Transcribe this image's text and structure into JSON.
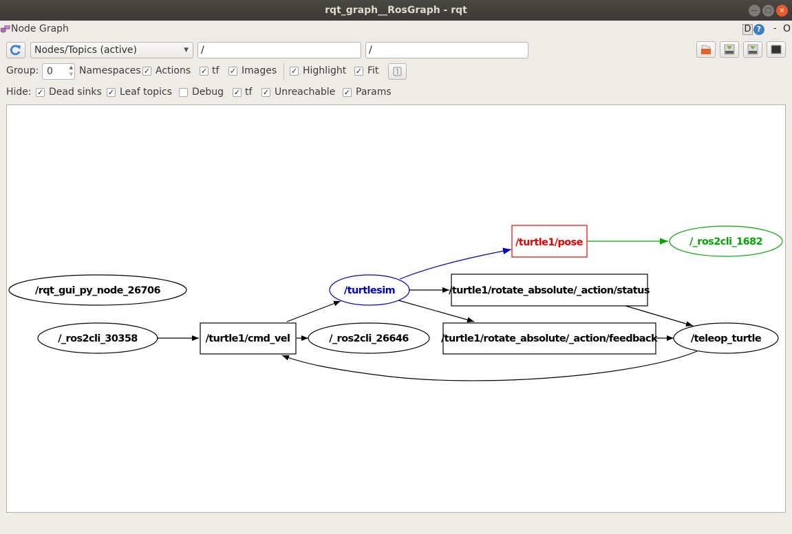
{
  "window": {
    "title": "rqt_graph__RosGraph - rqt",
    "controls": {
      "minimize": "—",
      "maximize": "□",
      "close": "×"
    }
  },
  "plugin": {
    "title": "Node Graph",
    "icon": "node-graph-icon",
    "dock_buttons": {
      "d": "D",
      "help": "?",
      "minus": "-",
      "close": "O"
    }
  },
  "toolbar": {
    "refresh_icon": "refresh-icon",
    "mode_select": {
      "value": "Nodes/Topics (active)"
    },
    "node_filter": {
      "value": "/"
    },
    "topic_filter": {
      "value": "/"
    },
    "right_buttons": [
      "load-dot-icon",
      "save-dot-icon",
      "save-image-icon",
      "fit-view-icon"
    ]
  },
  "options": {
    "group_label": "Group:",
    "group_value": "0",
    "namespaces_label": "Namespaces",
    "checks": [
      {
        "label": "Actions",
        "checked": true
      },
      {
        "label": "tf",
        "checked": true
      },
      {
        "label": "Images",
        "checked": true
      },
      {
        "label": "Highlight",
        "checked": true
      },
      {
        "label": "Fit",
        "checked": true
      }
    ]
  },
  "hide": {
    "label": "Hide:",
    "checks": [
      {
        "label": "Dead sinks",
        "checked": true
      },
      {
        "label": "Leaf topics",
        "checked": true
      },
      {
        "label": "Debug",
        "checked": false
      },
      {
        "label": "tf",
        "checked": true
      },
      {
        "label": "Unreachable",
        "checked": true
      },
      {
        "label": "Params",
        "checked": true
      }
    ]
  },
  "graph": {
    "colors": {
      "default": "#000000",
      "selected": "#0000cc",
      "outgoing": "#ee0000",
      "incoming": "#00aa00"
    },
    "nodes": [
      {
        "id": "rqt_gui",
        "label": "/rqt_gui_py_node_26706",
        "shape": "ellipse",
        "color": "#000000"
      },
      {
        "id": "ros2cli_30358",
        "label": "/_ros2cli_30358",
        "shape": "ellipse",
        "color": "#000000"
      },
      {
        "id": "cmd_vel",
        "label": "/turtle1/cmd_vel",
        "shape": "box",
        "color": "#000000"
      },
      {
        "id": "ros2cli_26646",
        "label": "/_ros2cli_26646",
        "shape": "ellipse",
        "color": "#000000"
      },
      {
        "id": "turtlesim",
        "label": "/turtlesim",
        "shape": "ellipse",
        "color": "#0000cc"
      },
      {
        "id": "pose",
        "label": "/turtle1/pose",
        "shape": "box",
        "color": "#ee0000"
      },
      {
        "id": "ros2cli_1682",
        "label": "/_ros2cli_1682",
        "shape": "ellipse",
        "color": "#00aa00"
      },
      {
        "id": "status",
        "label": "/turtle1/rotate_absolute/_action/status",
        "shape": "box",
        "color": "#000000"
      },
      {
        "id": "feedback",
        "label": "/turtle1/rotate_absolute/_action/feedback",
        "shape": "box",
        "color": "#000000"
      },
      {
        "id": "teleop",
        "label": "/teleop_turtle",
        "shape": "ellipse",
        "color": "#000000"
      }
    ],
    "edges": [
      {
        "from": "ros2cli_30358",
        "to": "cmd_vel",
        "color": "#000000"
      },
      {
        "from": "cmd_vel",
        "to": "ros2cli_26646",
        "color": "#000000"
      },
      {
        "from": "cmd_vel",
        "to": "turtlesim",
        "color": "#000000"
      },
      {
        "from": "turtlesim",
        "to": "pose",
        "color": "#0000cc"
      },
      {
        "from": "pose",
        "to": "ros2cli_1682",
        "color": "#00aa00"
      },
      {
        "from": "turtlesim",
        "to": "status",
        "color": "#000000"
      },
      {
        "from": "turtlesim",
        "to": "feedback",
        "color": "#000000"
      },
      {
        "from": "status",
        "to": "teleop",
        "color": "#000000"
      },
      {
        "from": "feedback",
        "to": "teleop",
        "color": "#000000"
      },
      {
        "from": "teleop",
        "to": "cmd_vel",
        "color": "#000000"
      }
    ]
  }
}
